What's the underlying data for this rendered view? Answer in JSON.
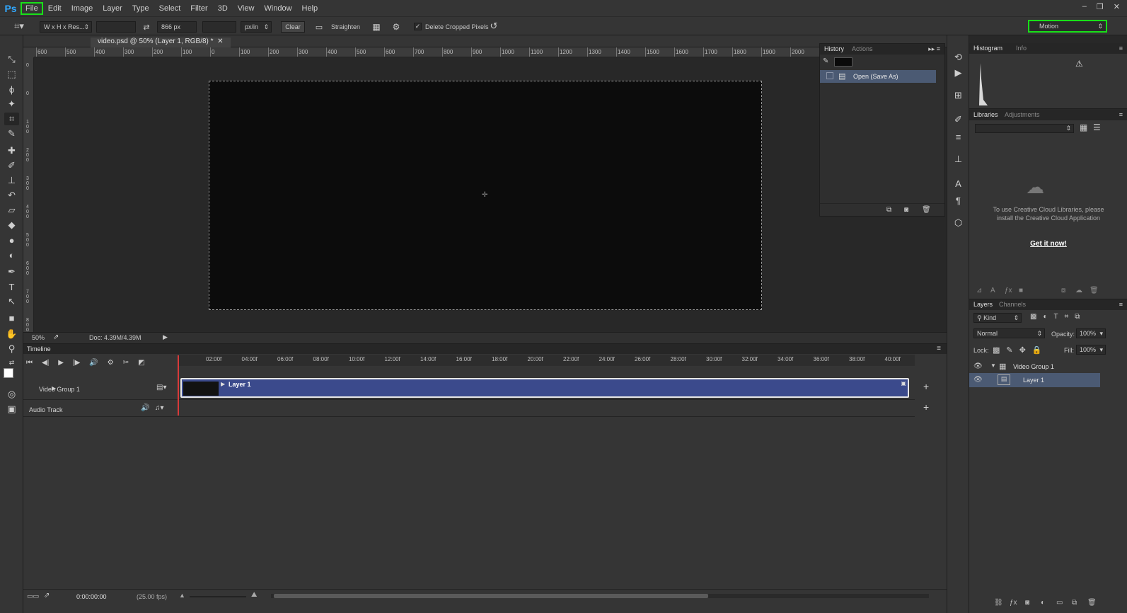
{
  "menubar": {
    "logo": "Ps",
    "items": [
      "File",
      "Edit",
      "Image",
      "Layer",
      "Type",
      "Select",
      "Filter",
      "3D",
      "View",
      "Window",
      "Help"
    ],
    "window_controls": [
      "–",
      "❐",
      "✕"
    ]
  },
  "options": {
    "ratio_preset": "W x H x Res...",
    "width_value": "",
    "height_value": "866 px",
    "resolution_value": "",
    "resolution_unit": "px/in",
    "clear_label": "Clear",
    "straighten_label": "Straighten",
    "delete_cropped_label": "Delete Cropped Pixels",
    "delete_cropped_checked": true,
    "workspace": "Motion"
  },
  "document": {
    "tab_title": "video.psd @ 50% (Layer 1, RGB/8) *",
    "ruler_h": [
      "600",
      "500",
      "400",
      "300",
      "200",
      "100",
      "0",
      "100",
      "200",
      "300",
      "400",
      "500",
      "600",
      "700",
      "800",
      "900",
      "1000",
      "1100",
      "1200",
      "1300",
      "1400",
      "1500",
      "1600",
      "1700",
      "1800",
      "1900",
      "2000"
    ],
    "ruler_v": [
      "0",
      "0",
      "1 0 0",
      "2 0 0",
      "3 0 0",
      "4 0 0",
      "5 0 0",
      "6 0 0",
      "7 0 0",
      "8 0 0"
    ],
    "zoom": "50%",
    "doc_size": "Doc: 4.39M/4.39M"
  },
  "history": {
    "tabs": [
      "History",
      "Actions"
    ],
    "active_tab": "History",
    "items": [
      "Open (Save As)"
    ]
  },
  "histogram": {
    "tabs": [
      "Histogram",
      "Info"
    ],
    "active_tab": "Histogram",
    "warning": "⚠"
  },
  "libraries": {
    "tabs": [
      "Libraries",
      "Adjustments"
    ],
    "active_tab": "Libraries",
    "message": "To use Creative Cloud Libraries, please install the Creative Cloud Application",
    "link": "Get it now!"
  },
  "layers": {
    "tabs": [
      "Layers",
      "Channels"
    ],
    "active_tab": "Layers",
    "filter_kind": "Kind",
    "blend_mode": "Normal",
    "opacity_label": "Opacity:",
    "opacity_value": "100%",
    "lock_label": "Lock:",
    "fill_label": "Fill:",
    "fill_value": "100%",
    "rows": [
      {
        "name": "Video Group 1",
        "selected": false
      },
      {
        "name": "Layer 1",
        "selected": true
      }
    ]
  },
  "timeline": {
    "title": "Timeline",
    "ruler": [
      "02:00f",
      "04:00f",
      "06:00f",
      "08:00f",
      "10:00f",
      "12:00f",
      "14:00f",
      "16:00f",
      "18:00f",
      "20:00f",
      "22:00f",
      "24:00f",
      "26:00f",
      "28:00f",
      "30:00f",
      "32:00f",
      "34:00f",
      "36:00f",
      "38:00f",
      "40:00f"
    ],
    "track_video": "Video Group 1",
    "track_audio": "Audio Track",
    "clip_label": "Layer 1",
    "timecode": "0:00:00:00",
    "fps": "(25.00 fps)"
  }
}
